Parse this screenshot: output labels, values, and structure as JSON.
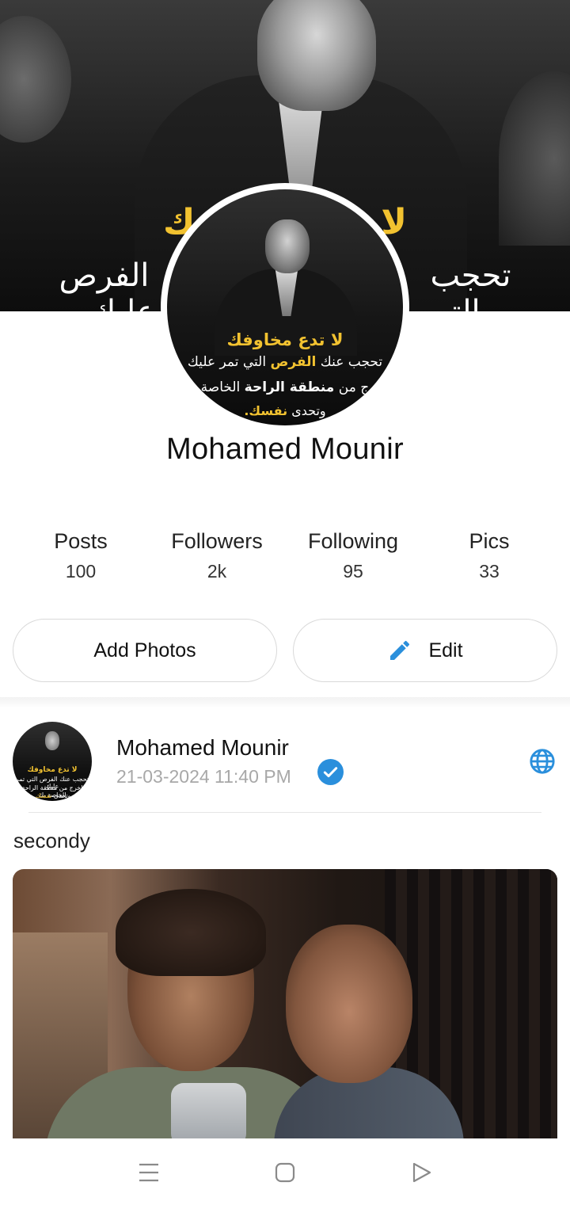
{
  "cover": {
    "line1": "لا تدع مخاوفك",
    "line2": "تحجب عنك الفرص التي تمر عليك"
  },
  "avatar": {
    "line1": "لا تدع مخاوفك",
    "line2_pre": "تحجب عنك ",
    "line2_hl": "الفرص",
    "line2_post": " التي تمر عليك",
    "line3_pre": "اخرج من ",
    "line3_hl": "منطقة الراحة",
    "line3_post": " الخاصة بك",
    "line4_pre": "وتحدى ",
    "line4_hl": "نفسك."
  },
  "profile": {
    "name": "Mohamed Mounir"
  },
  "stats": [
    {
      "label": "Posts",
      "value": "100"
    },
    {
      "label": "Followers",
      "value": "2k"
    },
    {
      "label": "Following",
      "value": "95"
    },
    {
      "label": "Pics",
      "value": "33"
    }
  ],
  "actions": {
    "add_photos": "Add Photos",
    "edit": "Edit"
  },
  "post": {
    "author": "Mohamed Mounir",
    "date": "21-03-2024 11:40 PM",
    "text": "secondy",
    "verified": true,
    "visibility_icon": "globe-icon"
  },
  "colors": {
    "accent": "#2a8fdc",
    "quote_yellow": "#f2c230"
  },
  "navbar": {
    "icons": [
      "menu-icon",
      "home-square-icon",
      "back-triangle-icon"
    ]
  }
}
